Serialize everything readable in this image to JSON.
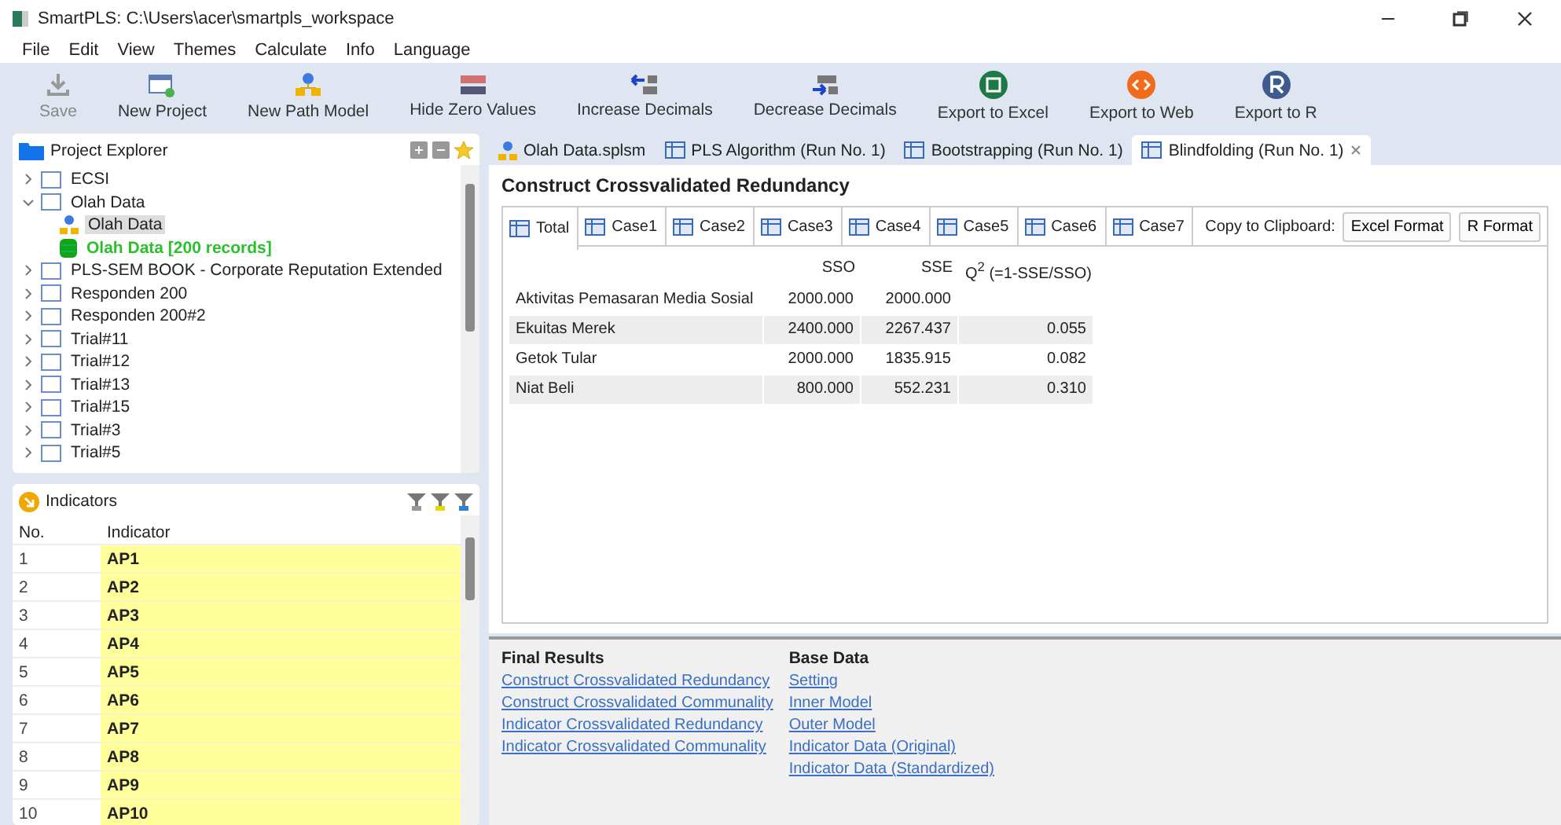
{
  "window": {
    "title": "SmartPLS: C:\\Users\\acer\\smartpls_workspace"
  },
  "menu": [
    "File",
    "Edit",
    "View",
    "Themes",
    "Calculate",
    "Info",
    "Language"
  ],
  "toolbar": [
    {
      "kind": "save",
      "label": "Save",
      "disabled": true
    },
    {
      "kind": "project",
      "label": "New Project",
      "disabled": false
    },
    {
      "kind": "path",
      "label": "New Path Model",
      "disabled": false
    },
    {
      "kind": "hide",
      "label": "Hide Zero Values",
      "disabled": false
    },
    {
      "kind": "inc",
      "label": "Increase Decimals",
      "disabled": false
    },
    {
      "kind": "dec",
      "label": "Decrease Decimals",
      "disabled": false
    },
    {
      "kind": "excel",
      "label": "Export to Excel",
      "disabled": false
    },
    {
      "kind": "web",
      "label": "Export to Web",
      "disabled": false
    },
    {
      "kind": "r",
      "label": "Export to R",
      "disabled": false
    }
  ],
  "explorer": {
    "title": "Project Explorer",
    "items": [
      {
        "label": "ECSI",
        "expanded": false
      },
      {
        "label": "Olah Data",
        "expanded": true,
        "children": [
          {
            "kind": "model",
            "label": "Olah Data",
            "selected": true
          },
          {
            "kind": "data",
            "label": "Olah Data [200 records]",
            "selected": false
          }
        ]
      },
      {
        "label": "PLS-SEM BOOK - Corporate Reputation Extended",
        "expanded": false
      },
      {
        "label": "Responden 200",
        "expanded": false
      },
      {
        "label": "Responden 200#2",
        "expanded": false
      },
      {
        "label": "Trial#11",
        "expanded": false
      },
      {
        "label": "Trial#12",
        "expanded": false
      },
      {
        "label": "Trial#13",
        "expanded": false
      },
      {
        "label": "Trial#15",
        "expanded": false
      },
      {
        "label": "Trial#3",
        "expanded": false
      },
      {
        "label": "Trial#5",
        "expanded": false
      }
    ]
  },
  "indicators": {
    "title": "Indicators",
    "columns": [
      "No.",
      "Indicator"
    ],
    "rows": [
      [
        "1",
        "AP1"
      ],
      [
        "2",
        "AP2"
      ],
      [
        "3",
        "AP3"
      ],
      [
        "4",
        "AP4"
      ],
      [
        "5",
        "AP5"
      ],
      [
        "6",
        "AP6"
      ],
      [
        "7",
        "AP7"
      ],
      [
        "8",
        "AP8"
      ],
      [
        "9",
        "AP9"
      ],
      [
        "10",
        "AP10"
      ]
    ]
  },
  "editor_tabs": [
    {
      "kind": "model",
      "label": "Olah Data.splsm",
      "selected": false
    },
    {
      "kind": "table",
      "label": "PLS Algorithm (Run No. 1)",
      "selected": false
    },
    {
      "kind": "table",
      "label": "Bootstrapping (Run No. 1)",
      "selected": false
    },
    {
      "kind": "table",
      "label": "Blindfolding (Run No. 1)",
      "selected": true
    }
  ],
  "report": {
    "title": "Construct Crossvalidated Redundancy",
    "tabs": [
      {
        "label": "Total",
        "selected": true
      },
      {
        "label": "Case1",
        "selected": false
      },
      {
        "label": "Case2",
        "selected": false
      },
      {
        "label": "Case3",
        "selected": false
      },
      {
        "label": "Case4",
        "selected": false
      },
      {
        "label": "Case5",
        "selected": false
      },
      {
        "label": "Case6",
        "selected": false
      },
      {
        "label": "Case7",
        "selected": false
      }
    ],
    "copy_label": "Copy to Clipboard:",
    "copy_buttons": [
      "Excel Format",
      "R Format"
    ],
    "columns": [
      "",
      "SSO",
      "SSE",
      "Q$^{2}$ (=1-SSE/SSO)"
    ],
    "rows": [
      [
        "Aktivitas Pemasaran Media Sosial",
        "2000.000",
        "2000.000",
        ""
      ],
      [
        "Ekuitas Merek",
        "2400.000",
        "2267.437",
        "0.055"
      ],
      [
        "Getok Tular",
        "2000.000",
        "1835.915",
        "0.082"
      ],
      [
        "Niat Beli",
        "800.000",
        "552.231",
        "0.310"
      ]
    ]
  },
  "navigation": [
    {
      "heading": "Final Results",
      "links": [
        "Construct Crossvalidated Redundancy",
        "Construct Crossvalidated Communality",
        "Indicator Crossvalidated Redundancy",
        "Indicator Crossvalidated Communality"
      ]
    },
    {
      "heading": "Base Data",
      "links": [
        "Setting",
        "Inner Model",
        "Outer Model",
        "Indicator Data (Original)",
        "Indicator Data (Standardized)"
      ]
    }
  ]
}
